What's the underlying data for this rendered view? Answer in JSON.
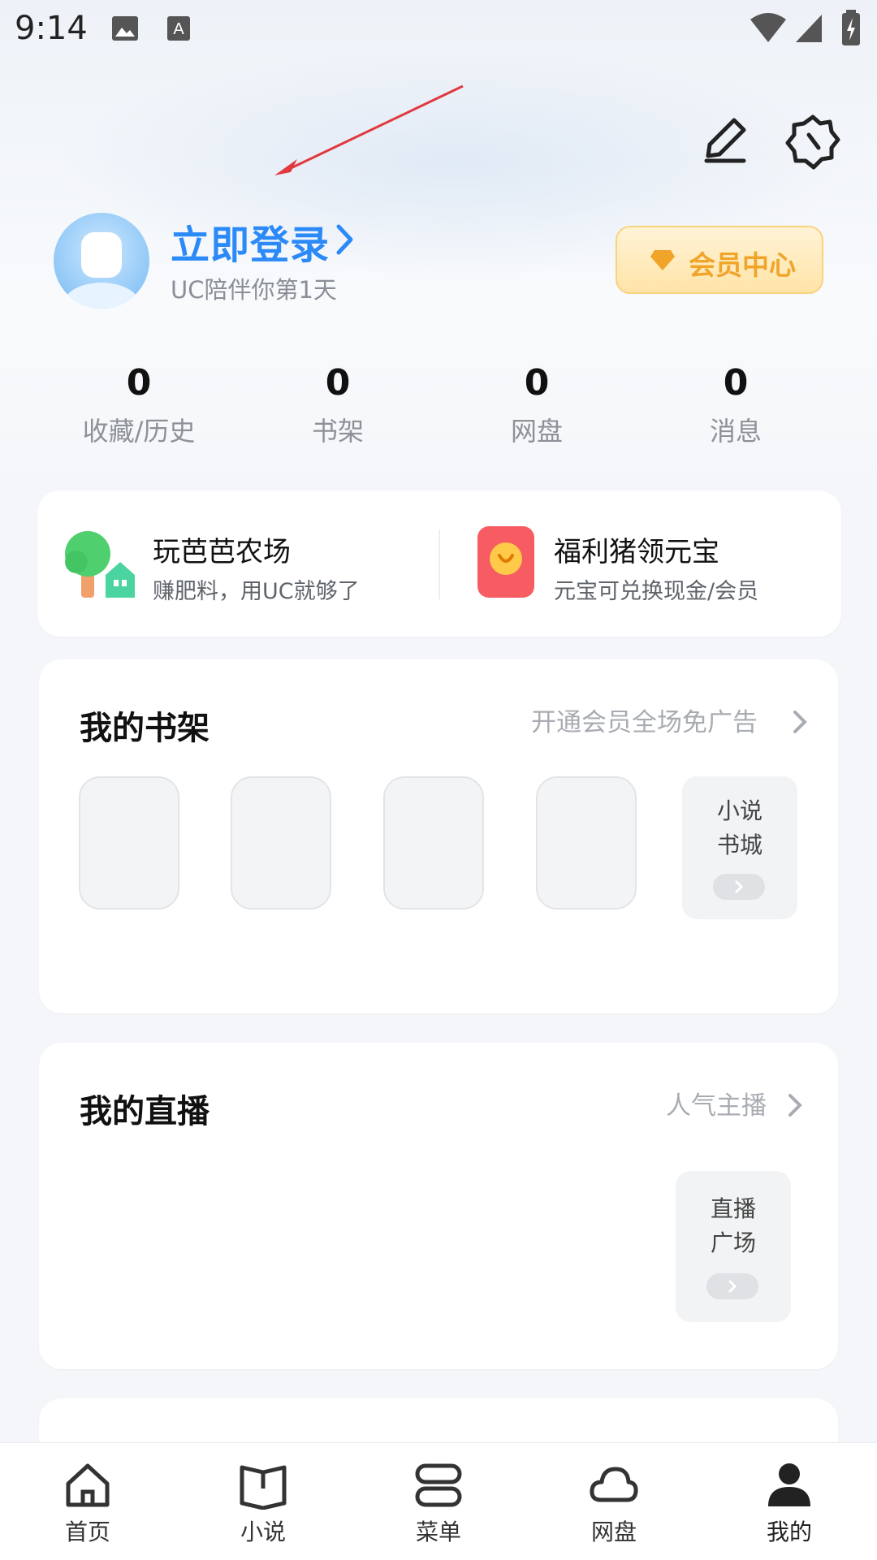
{
  "status_bar": {
    "time": "9:14"
  },
  "profile": {
    "login_label": "立即登录",
    "subtitle": "UC陪伴你第1天",
    "vip_label": "会员中心"
  },
  "stats": [
    {
      "value": "0",
      "label": "收藏/历史"
    },
    {
      "value": "0",
      "label": "书架"
    },
    {
      "value": "0",
      "label": "网盘"
    },
    {
      "value": "0",
      "label": "消息"
    }
  ],
  "promos": [
    {
      "title": "玩芭芭农场",
      "subtitle": "赚肥料，用UC就够了"
    },
    {
      "title": "福利猪领元宝",
      "subtitle": "元宝可兑换现金/会员"
    }
  ],
  "bookshelf": {
    "title": "我的书架",
    "link": "开通会员全场免广告",
    "side_tile": [
      "小说",
      "书城"
    ]
  },
  "live": {
    "title": "我的直播",
    "link": "人气主播",
    "side_tile": [
      "直播",
      "广场"
    ]
  },
  "tabs": [
    {
      "label": "首页",
      "icon": "home-icon"
    },
    {
      "label": "小说",
      "icon": "book-icon"
    },
    {
      "label": "菜单",
      "icon": "menu-icon"
    },
    {
      "label": "网盘",
      "icon": "cloud-icon"
    },
    {
      "label": "我的",
      "icon": "person-icon"
    }
  ],
  "colors": {
    "accent": "#2b8af7",
    "vip": "#f0a42a",
    "annotation": "#e0393e"
  }
}
